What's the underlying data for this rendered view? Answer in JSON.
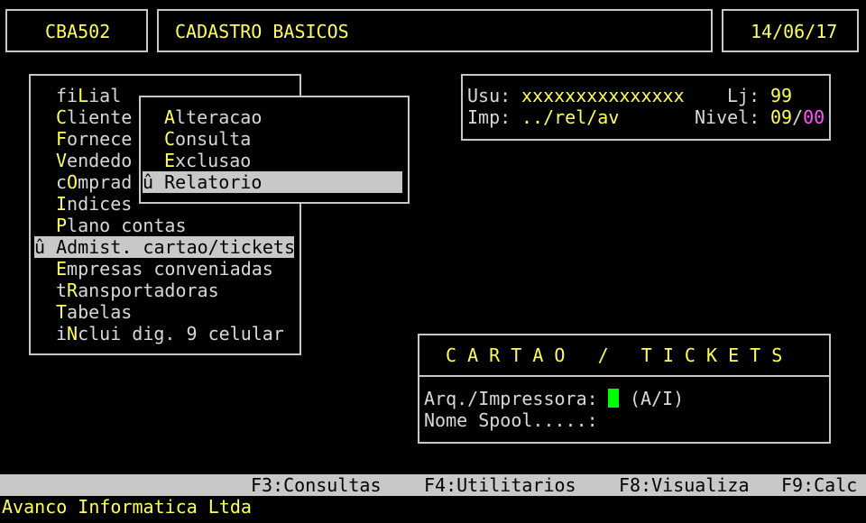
{
  "header": {
    "program_code": "CBA502",
    "screen_title": "CADASTRO BASICOS",
    "date": "14/06/17"
  },
  "main_menu": {
    "selected_marker": "û",
    "items": [
      {
        "pre": "fi",
        "hot": "L",
        "post": "ial"
      },
      {
        "pre": "",
        "hot": "C",
        "post": "liente"
      },
      {
        "pre": "",
        "hot": "F",
        "post": "ornece"
      },
      {
        "pre": "",
        "hot": "V",
        "post": "endedo"
      },
      {
        "pre": "c",
        "hot": "O",
        "post": "mprad"
      },
      {
        "pre": "",
        "hot": "I",
        "post": "ndices"
      },
      {
        "pre": "",
        "hot": "P",
        "post": "lano contas"
      },
      {
        "pre": "",
        "hot": "A",
        "post": "dmist. cartao/tickets"
      },
      {
        "pre": "",
        "hot": "E",
        "post": "mpresas conveniadas"
      },
      {
        "pre": "t",
        "hot": "R",
        "post": "ansportadoras"
      },
      {
        "pre": "",
        "hot": "T",
        "post": "abelas"
      },
      {
        "pre": "i",
        "hot": "N",
        "post": "clui dig. 9 celular"
      }
    ]
  },
  "sub_menu": {
    "items": [
      {
        "hot": "A",
        "post": "lteracao"
      },
      {
        "hot": "C",
        "post": "onsulta"
      },
      {
        "hot": "E",
        "post": "xclusao"
      },
      {
        "hot": "R",
        "post": "elatorio"
      }
    ]
  },
  "user_panel": {
    "usu_label": "Usu:",
    "usu_value": "xxxxxxxxxxxxxxx",
    "lj_label": "Lj:",
    "lj_value": "99",
    "imp_label": "Imp:",
    "imp_value": "../rel/av",
    "nivel_label": "Nivel:",
    "nivel_value_a": "09",
    "nivel_sep": "/",
    "nivel_value_b": "00"
  },
  "cartao_panel": {
    "title": "C A R T A O   /   T I C K E T S",
    "arq_label": "Arq./Impressora:",
    "arq_hint": "(A/I)",
    "spool_label": "Nome Spool.....:"
  },
  "function_bar": {
    "f3": "F3:Consultas",
    "f4": "F4:Utilitarios",
    "f8": "F8:Visualiza",
    "f9": "F9:Calc"
  },
  "footer": {
    "company": "Avanco Informatica Ltda"
  },
  "colors": {
    "yellow": "#ffff55",
    "gray": "#d8d8d8",
    "magenta": "#ff55ff",
    "cursor_green": "#00ff00",
    "selection_bar": "#c8c8c8"
  }
}
